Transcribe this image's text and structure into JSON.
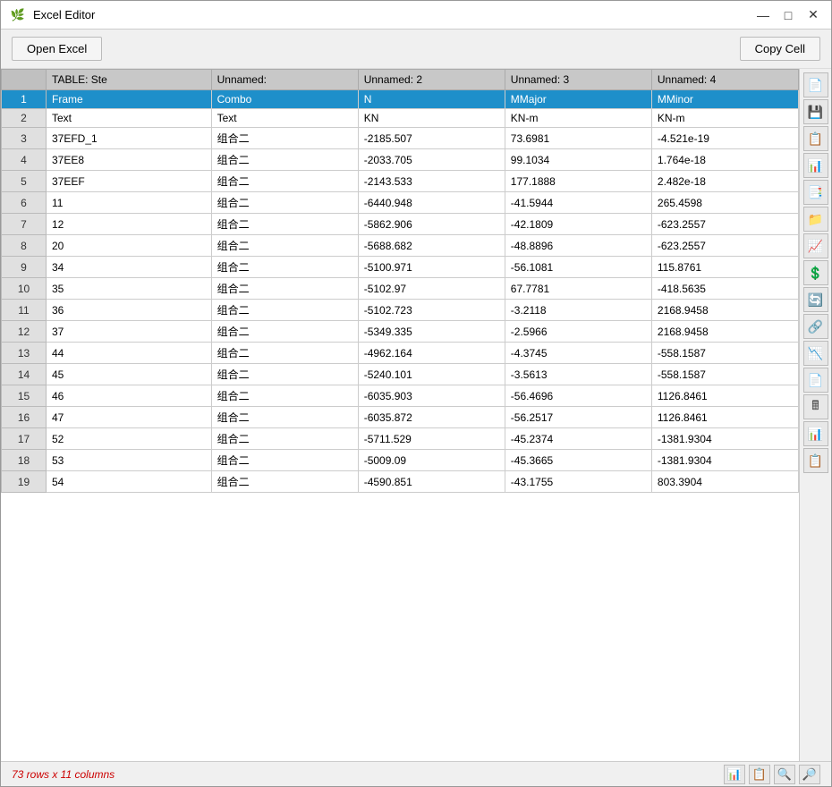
{
  "window": {
    "title": "Excel Editor",
    "icon": "📋"
  },
  "titlebar": {
    "minimize_label": "—",
    "maximize_label": "□",
    "close_label": "✕"
  },
  "toolbar": {
    "open_excel_label": "Open Excel",
    "copy_cell_label": "Copy Cell"
  },
  "table": {
    "headers": [
      "",
      "TABLE:  Ste",
      "Unnamed:",
      "Unnamed: 2",
      "Unnamed: 3",
      "Unnamed: 4"
    ],
    "rows": [
      {
        "num": "1",
        "col1": "Frame",
        "col2": "Combo",
        "col3": "N",
        "col4": "MMajor",
        "col5": "MMinor",
        "selected": true
      },
      {
        "num": "2",
        "col1": "Text",
        "col2": "Text",
        "col3": "KN",
        "col4": "KN-m",
        "col5": "KN-m",
        "selected": false
      },
      {
        "num": "3",
        "col1": "37EFD_1",
        "col2": "组合二",
        "col3": "-2185.507",
        "col4": "73.6981",
        "col5": "-4.521e-19",
        "selected": false
      },
      {
        "num": "4",
        "col1": "37EE8",
        "col2": "组合二",
        "col3": "-2033.705",
        "col4": "99.1034",
        "col5": "1.764e-18",
        "selected": false
      },
      {
        "num": "5",
        "col1": "37EEF",
        "col2": "组合二",
        "col3": "-2143.533",
        "col4": "177.1888",
        "col5": "2.482e-18",
        "selected": false
      },
      {
        "num": "6",
        "col1": "11",
        "col2": "组合二",
        "col3": "-6440.948",
        "col4": "-41.5944",
        "col5": "265.4598",
        "selected": false
      },
      {
        "num": "7",
        "col1": "12",
        "col2": "组合二",
        "col3": "-5862.906",
        "col4": "-42.1809",
        "col5": "-623.2557",
        "selected": false
      },
      {
        "num": "8",
        "col1": "20",
        "col2": "组合二",
        "col3": "-5688.682",
        "col4": "-48.8896",
        "col5": "-623.2557",
        "selected": false
      },
      {
        "num": "9",
        "col1": "34",
        "col2": "组合二",
        "col3": "-5100.971",
        "col4": "-56.1081",
        "col5": "115.8761",
        "selected": false
      },
      {
        "num": "10",
        "col1": "35",
        "col2": "组合二",
        "col3": "-5102.97",
        "col4": "67.7781",
        "col5": "-418.5635",
        "selected": false
      },
      {
        "num": "11",
        "col1": "36",
        "col2": "组合二",
        "col3": "-5102.723",
        "col4": "-3.2118",
        "col5": "2168.9458",
        "selected": false
      },
      {
        "num": "12",
        "col1": "37",
        "col2": "组合二",
        "col3": "-5349.335",
        "col4": "-2.5966",
        "col5": "2168.9458",
        "selected": false
      },
      {
        "num": "13",
        "col1": "44",
        "col2": "组合二",
        "col3": "-4962.164",
        "col4": "-4.3745",
        "col5": "-558.1587",
        "selected": false
      },
      {
        "num": "14",
        "col1": "45",
        "col2": "组合二",
        "col3": "-5240.101",
        "col4": "-3.5613",
        "col5": "-558.1587",
        "selected": false
      },
      {
        "num": "15",
        "col1": "46",
        "col2": "组合二",
        "col3": "-6035.903",
        "col4": "-56.4696",
        "col5": "1126.8461",
        "selected": false
      },
      {
        "num": "16",
        "col1": "47",
        "col2": "组合二",
        "col3": "-6035.872",
        "col4": "-56.2517",
        "col5": "1126.8461",
        "selected": false
      },
      {
        "num": "17",
        "col1": "52",
        "col2": "组合二",
        "col3": "-5711.529",
        "col4": "-45.2374",
        "col5": "-1381.9304",
        "selected": false
      },
      {
        "num": "18",
        "col1": "53",
        "col2": "组合二",
        "col3": "-5009.09",
        "col4": "-45.3665",
        "col5": "-1381.9304",
        "selected": false
      },
      {
        "num": "19",
        "col1": "54",
        "col2": "组合二",
        "col3": "-4590.851",
        "col4": "-43.1755",
        "col5": "803.3904",
        "selected": false
      }
    ]
  },
  "status": {
    "text": "73 rows x 11 columns"
  },
  "side_buttons": [
    {
      "icon": "📄",
      "name": "new-file-icon"
    },
    {
      "icon": "💾",
      "name": "save-icon"
    },
    {
      "icon": "📋",
      "name": "clipboard-icon"
    },
    {
      "icon": "📊",
      "name": "excel-icon"
    },
    {
      "icon": "📑",
      "name": "copy-icon"
    },
    {
      "icon": "📁",
      "name": "folder-icon"
    },
    {
      "icon": "📈",
      "name": "chart-icon"
    },
    {
      "icon": "💲",
      "name": "currency-icon"
    },
    {
      "icon": "🔄",
      "name": "refresh-icon"
    },
    {
      "icon": "🔗",
      "name": "link-icon"
    },
    {
      "icon": "📉",
      "name": "trend-icon"
    },
    {
      "icon": "📄",
      "name": "doc-icon"
    },
    {
      "icon": "🖩",
      "name": "calc-icon"
    },
    {
      "icon": "📊",
      "name": "chart2-icon"
    },
    {
      "icon": "📋",
      "name": "list-icon"
    }
  ],
  "status_bar_icons": [
    {
      "icon": "📊",
      "name": "excel-status-icon"
    },
    {
      "icon": "📋",
      "name": "copy-status-icon"
    },
    {
      "icon": "🔍",
      "name": "search-status-icon"
    },
    {
      "icon": "🔎",
      "name": "zoom-status-icon"
    }
  ]
}
